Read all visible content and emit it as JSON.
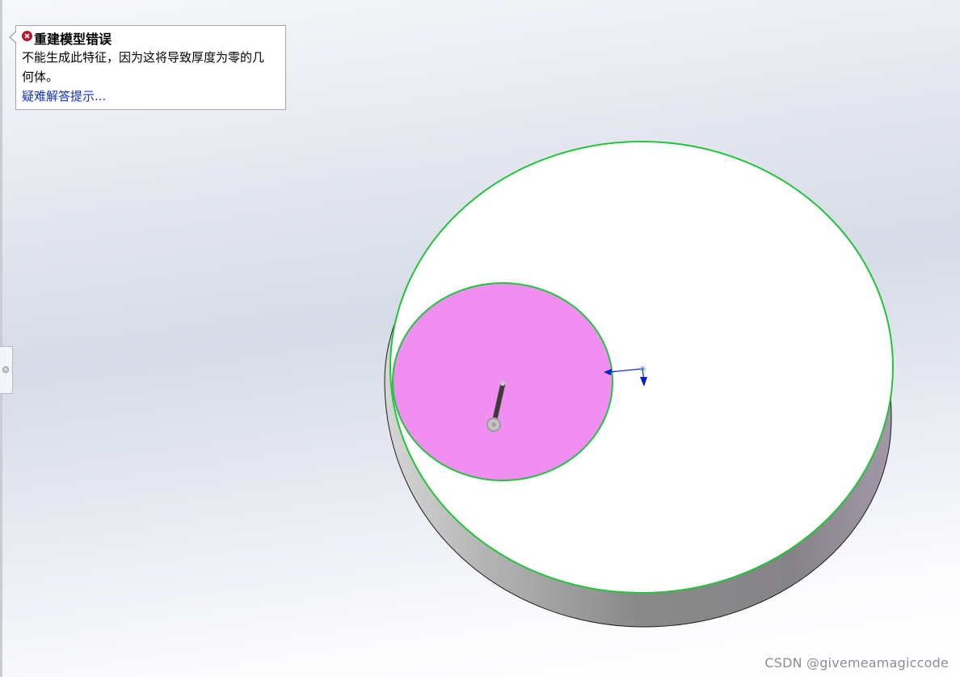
{
  "error_tooltip": {
    "icon": "error-icon",
    "title": "重建模型错误",
    "message": "不能生成此特征，因为这将导致厚度为零的几何体。",
    "link": "疑难解答提示..."
  },
  "model": {
    "disc_top_face_color": "#ffffff",
    "disc_side_gradient": [
      "#c4c4c4",
      "#8e8e8e",
      "#7e7e7e",
      "#9a8fa0"
    ],
    "selection_edge_color": "#21c43a",
    "cut_face_color": "#f08ef2",
    "triad_axis_color": "#0a1ed2"
  },
  "watermark": "CSDN @givemeamagiccode",
  "colors": {
    "background_top": "#f7f8fb",
    "background_mid": "#d6dbe7",
    "error_red": "#c8102e",
    "link_blue": "#1432c8"
  }
}
